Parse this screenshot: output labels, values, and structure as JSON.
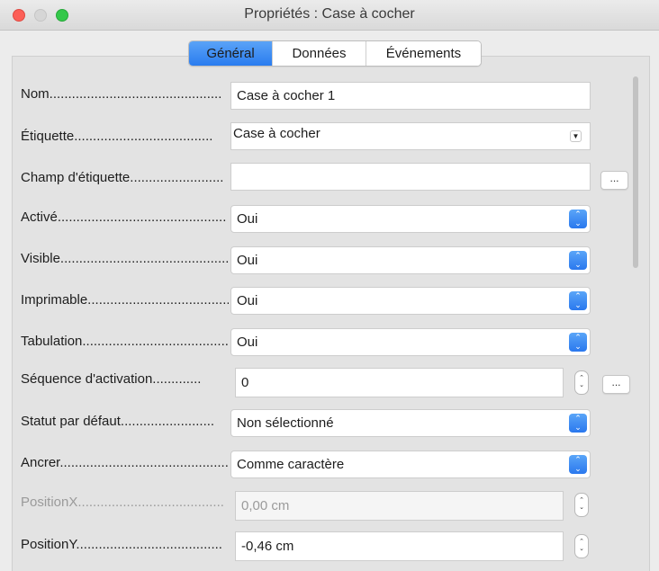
{
  "window": {
    "title": "Propriétés : Case à cocher"
  },
  "tabs": [
    {
      "label": "Général"
    },
    {
      "label": "Données"
    },
    {
      "label": "Événements"
    }
  ],
  "rows": {
    "nom": {
      "label": "Nom..............................................",
      "value": "Case à cocher 1"
    },
    "etiquette": {
      "label": "Étiquette.....................................",
      "value": "Case à cocher"
    },
    "champ_etiquette": {
      "label": "Champ d'étiquette.........................",
      "value": "",
      "button": "..."
    },
    "active": {
      "label": "Activé.............................................",
      "value": "Oui"
    },
    "visible": {
      "label": "Visible..............................................",
      "value": "Oui"
    },
    "imprimable": {
      "label": "Imprimable.......................................",
      "value": "Oui"
    },
    "tabulation": {
      "label": "Tabulation.........................................",
      "value": "Oui"
    },
    "sequence": {
      "label": "Séquence d'activation.............",
      "value": "0",
      "button": "..."
    },
    "statut": {
      "label": "Statut par défaut.........................",
      "value": "Non sélectionné"
    },
    "ancrer": {
      "label": "Ancrer..................................................",
      "value": "Comme caractère"
    },
    "position_x": {
      "label": "PositionX.......................................",
      "value": "0,00 cm"
    },
    "position_y": {
      "label": "PositionY.......................................",
      "value": "-0,46 cm"
    }
  },
  "colors": {
    "accent": "#2f7ff0",
    "close": "#fc5f57",
    "maximize": "#34c84a"
  },
  "icons": {
    "combo_arrow": "triangle-down",
    "select_stepper": "up-down-chevron",
    "spin": "up-down-chevron"
  }
}
